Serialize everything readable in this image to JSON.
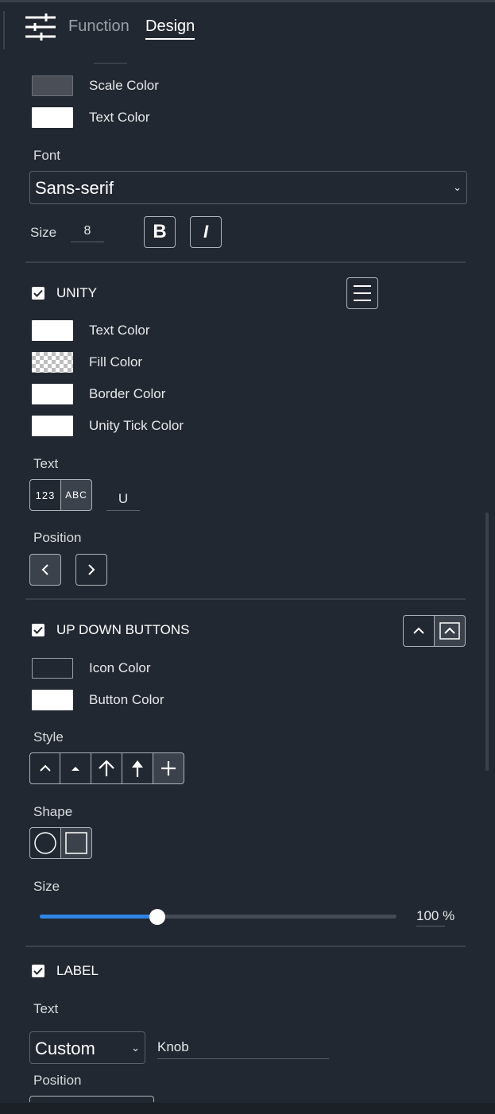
{
  "tabs": {
    "function": "Function",
    "design": "Design"
  },
  "scale": {
    "scale_color": "Scale Color",
    "text_color": "Text Color",
    "font_label": "Font",
    "font_value": "Sans-serif",
    "size_label": "Size",
    "size_value": "8",
    "bold": "B",
    "italic": "I"
  },
  "unity": {
    "title": "UNITY",
    "text_color": "Text Color",
    "fill_color": "Fill Color",
    "border_color": "Border Color",
    "tick_color": "Unity Tick Color",
    "text_label": "Text",
    "opt_123": "123",
    "opt_abc": "ABC",
    "text_value": "U",
    "position_label": "Position"
  },
  "updown": {
    "title": "UP DOWN BUTTONS",
    "icon_color": "Icon Color",
    "button_color": "Button Color",
    "style_label": "Style",
    "shape_label": "Shape",
    "size_label": "Size",
    "size_value": "100 %",
    "size_fraction": 0.33
  },
  "label": {
    "title": "LABEL",
    "text_label": "Text",
    "text_mode": "Custom",
    "text_value": "Knob",
    "position_label": "Position"
  },
  "colors": {
    "background": "#222831",
    "slider_fill": "#2e86e6",
    "slider_track": "#454b54"
  }
}
